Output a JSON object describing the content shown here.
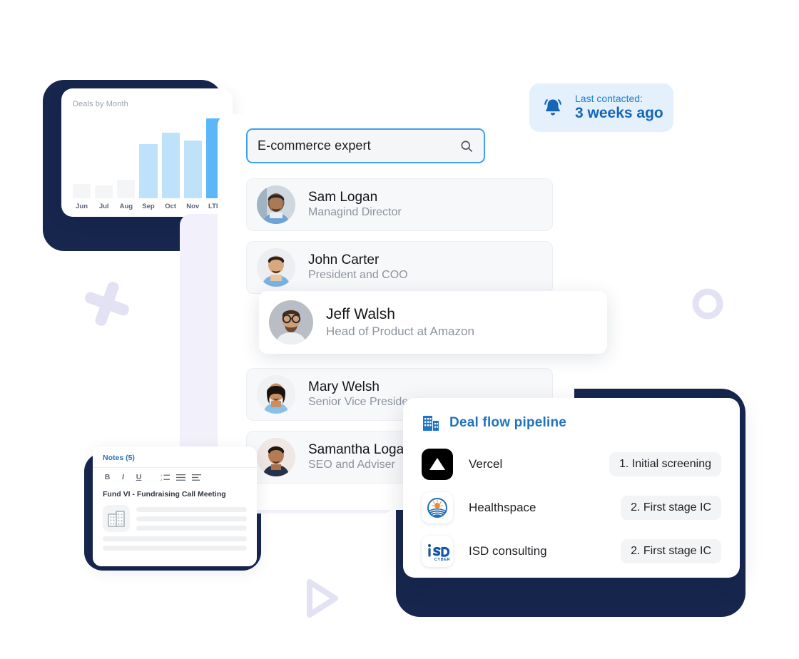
{
  "colors": {
    "navy_frame": "#16264d",
    "accent_blue": "#3ea0ef",
    "chart_accent": "#5db6f7",
    "chart_light": "#bfe2fb",
    "chart_grey": "#f4f5f7",
    "lavender_panel": "#f1f0fb",
    "badge_bg": "#e4f1fc",
    "badge_text": "#1565b8",
    "pipeline_title": "#1f72bd"
  },
  "chart_card": {
    "title": "Deals by Month"
  },
  "chart_data": {
    "type": "bar",
    "title": "Deals by Month",
    "categories": [
      "Jun",
      "Jul",
      "Aug",
      "Sep",
      "Oct",
      "Nov",
      "LTM"
    ],
    "values": [
      18,
      16,
      23,
      68,
      82,
      72,
      100
    ],
    "bar_styles": [
      "grey",
      "grey",
      "grey",
      "light",
      "light",
      "light",
      "accent"
    ],
    "xlabel": "",
    "ylabel": "",
    "ylim": [
      0,
      100
    ],
    "grid": false,
    "legend": false
  },
  "search": {
    "value": "E-commerce expert",
    "placeholder": "Search",
    "icon": "search-icon"
  },
  "contacts": [
    {
      "name": "Sam Logan",
      "role": "Managind Director",
      "featured": false
    },
    {
      "name": "John Carter",
      "role": "President and COO",
      "featured": false
    },
    {
      "name": "Jeff Walsh",
      "role": "Head of Product at Amazon",
      "featured": true
    },
    {
      "name": "Mary Welsh",
      "role": "Senior Vice President",
      "featured": false
    },
    {
      "name": "Samantha Logan",
      "role": "SEO and Adviser",
      "featured": false
    }
  ],
  "last_contacted_badge": {
    "icon": "bell-icon",
    "label": "Last contacted:",
    "value": "3 weeks ago"
  },
  "pipeline": {
    "icon": "building-icon",
    "title": "Deal flow pipeline",
    "deals": [
      {
        "company": "Vercel",
        "logo": "vercel-logo",
        "stage": "1. Initial screening"
      },
      {
        "company": "Healthspace",
        "logo": "healthspace-logo",
        "stage": "2. First stage IC"
      },
      {
        "company": "ISD consulting",
        "logo": "isd-cyber-logo",
        "stage": "2. First stage IC"
      }
    ]
  },
  "notes": {
    "title": "Notes (5)",
    "toolbar": [
      "B",
      "I",
      "U",
      "list-ordered-icon",
      "list-bullet-icon",
      "align-left-icon"
    ],
    "heading": "Fund VI - Fundraising Call Meeting"
  },
  "decorations": {
    "plus": "plus-decoration",
    "ring": "ring-decoration",
    "play": "play-decoration"
  }
}
